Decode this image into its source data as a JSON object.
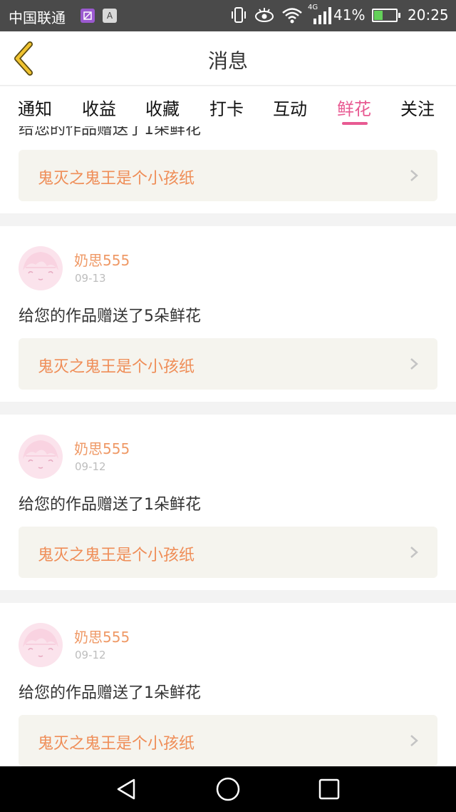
{
  "status_bar": {
    "carrier": "中国联通",
    "app_badge_2": "A",
    "network": "4G",
    "battery_percent": "41%",
    "battery_level": 0.41,
    "time": "20:25"
  },
  "header": {
    "title": "消息",
    "back_icon": "chevron-left-icon"
  },
  "tabs": [
    {
      "label": "通知",
      "active": false
    },
    {
      "label": "收益",
      "active": false
    },
    {
      "label": "收藏",
      "active": false
    },
    {
      "label": "打卡",
      "active": false
    },
    {
      "label": "互动",
      "active": false
    },
    {
      "label": "鲜花",
      "active": true
    },
    {
      "label": "关注",
      "active": false
    }
  ],
  "partial_card": {
    "cut_text": "给您的作品赠送了1朵鲜花",
    "link_title": "鬼灭之鬼王是个小孩纸"
  },
  "messages": [
    {
      "username": "奶思555",
      "date": "09-13",
      "text": "给您的作品赠送了5朵鲜花",
      "link_title": "鬼灭之鬼王是个小孩纸"
    },
    {
      "username": "奶思555",
      "date": "09-12",
      "text": "给您的作品赠送了1朵鲜花",
      "link_title": "鬼灭之鬼王是个小孩纸"
    },
    {
      "username": "奶思555",
      "date": "09-12",
      "text": "给您的作品赠送了1朵鲜花",
      "link_title": "鬼灭之鬼王是个小孩纸"
    }
  ],
  "colors": {
    "accent_pink": "#e85a92",
    "username_orange": "#ef9966",
    "link_orange": "#ef8d57",
    "back_yellow": "#f0c330"
  },
  "nav_icons": [
    "back-triangle-icon",
    "home-circle-icon",
    "recents-square-icon"
  ]
}
